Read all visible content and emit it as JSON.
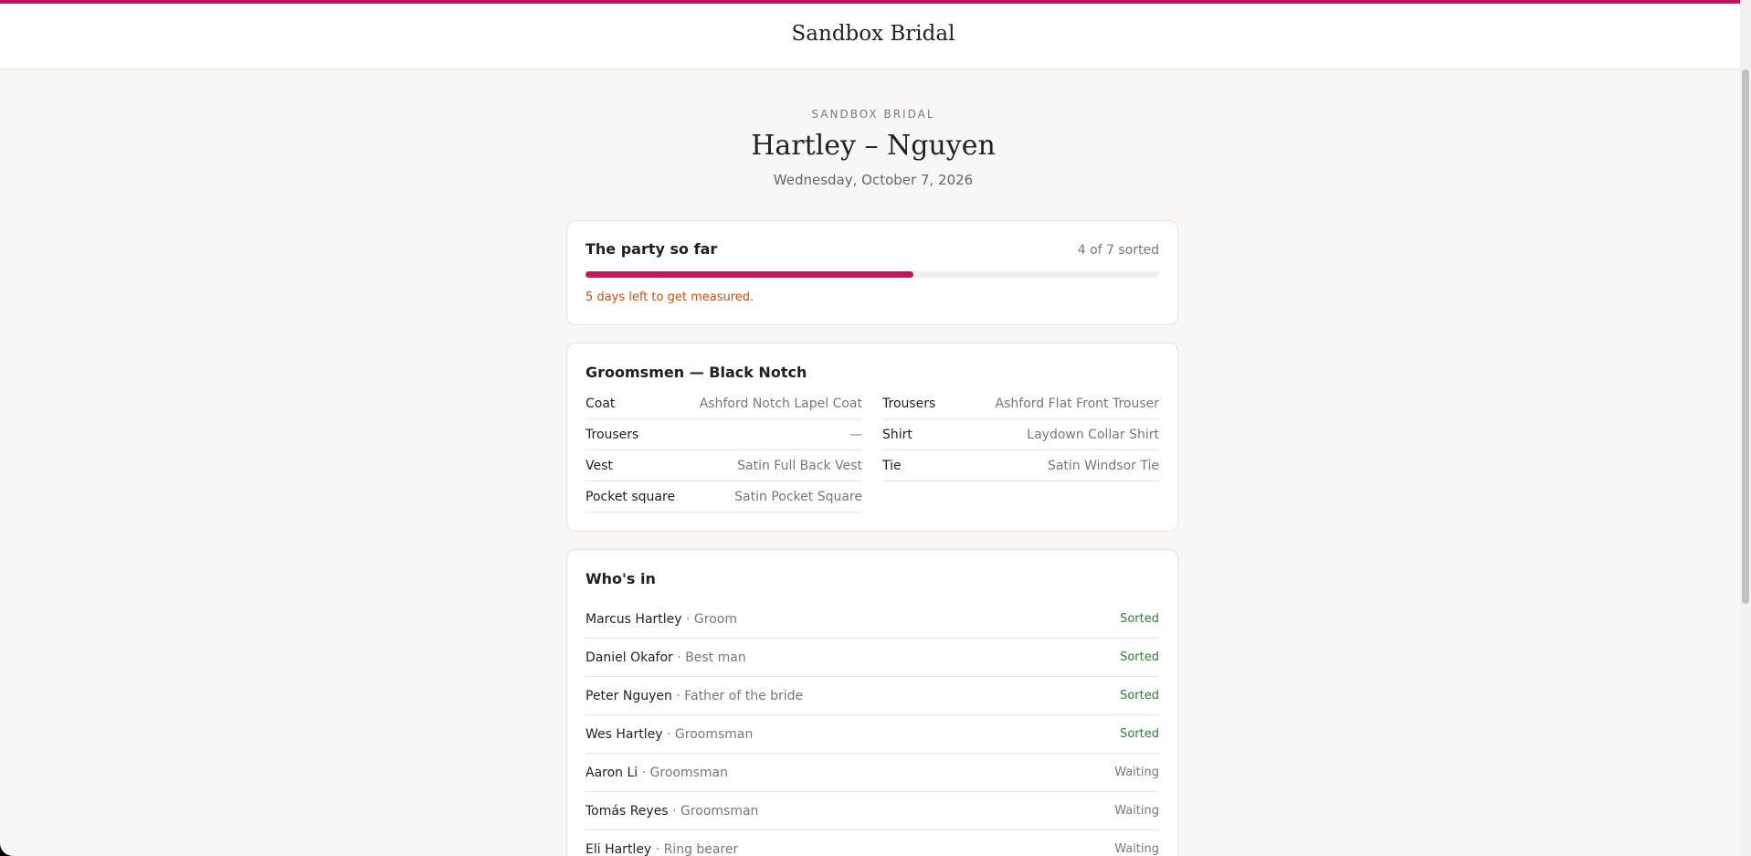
{
  "header": {
    "brand": "Sandbox Bridal",
    "accent_color": "#c2185b"
  },
  "event": {
    "eyebrow": "SANDBOX BRIDAL",
    "couple": "Hartley – Nguyen",
    "date": "Wednesday, October 7, 2026"
  },
  "progress": {
    "title": "The party so far",
    "count_label": "4 of 7 sorted",
    "sorted": 4,
    "total": 7,
    "fraction": 0.571,
    "deadline": "5 days left to get measured."
  },
  "outfit": {
    "title": "Groomsmen — Black Notch",
    "left": [
      {
        "label": "Coat",
        "value": "Ashford Notch Lapel Coat"
      },
      {
        "label": "Trousers",
        "value": "—"
      },
      {
        "label": "Vest",
        "value": "Satin Full Back Vest"
      },
      {
        "label": "Pocket square",
        "value": "Satin Pocket Square"
      }
    ],
    "right": [
      {
        "label": "Trousers",
        "value": "Ashford Flat Front Trouser"
      },
      {
        "label": "Shirt",
        "value": "Laydown Collar Shirt"
      },
      {
        "label": "Tie",
        "value": "Satin Windsor Tie"
      }
    ]
  },
  "roster": {
    "title": "Who's in",
    "separator": "·",
    "members": [
      {
        "name": "Marcus Hartley",
        "role": "Groom",
        "status": "Sorted"
      },
      {
        "name": "Daniel Okafor",
        "role": "Best man",
        "status": "Sorted"
      },
      {
        "name": "Peter Nguyen",
        "role": "Father of the bride",
        "status": "Sorted"
      },
      {
        "name": "Wes Hartley",
        "role": "Groomsman",
        "status": "Sorted"
      },
      {
        "name": "Aaron Li",
        "role": "Groomsman",
        "status": "Waiting"
      },
      {
        "name": "Tomás Reyes",
        "role": "Groomsman",
        "status": "Waiting"
      },
      {
        "name": "Eli Hartley",
        "role": "Ring bearer",
        "status": "Waiting"
      }
    ],
    "status_colors": {
      "Sorted": "#2e7d32",
      "Waiting": "#777777"
    }
  }
}
